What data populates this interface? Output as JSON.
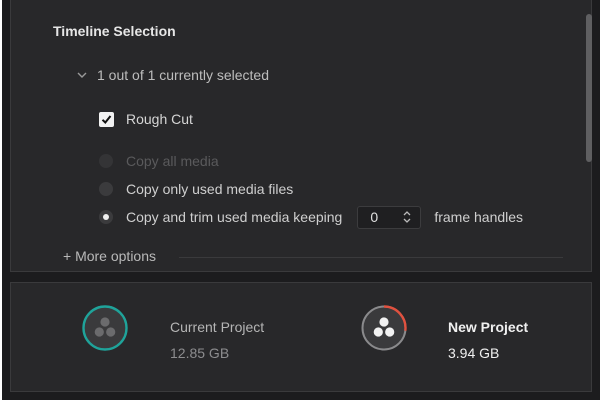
{
  "section_title": "Timeline Selection",
  "disclosure_label": "1 out of 1 currently selected",
  "timeline": {
    "label": "Rough Cut",
    "checked": true
  },
  "options": {
    "copy_all": "Copy all media",
    "copy_used": "Copy only used media files",
    "copy_trim": "Copy and trim used media keeping",
    "frame_handles_value": "0",
    "frame_handles_suffix": "frame handles",
    "selected": "copy_trim"
  },
  "more_options": "+ More options",
  "current_project": {
    "label": "Current Project",
    "size": "12.85 GB",
    "ring_color": "#1fa39a"
  },
  "new_project": {
    "label": "New Project",
    "size": "3.94 GB",
    "ring_color": "#e0513f",
    "progress_fraction": 0.27
  }
}
